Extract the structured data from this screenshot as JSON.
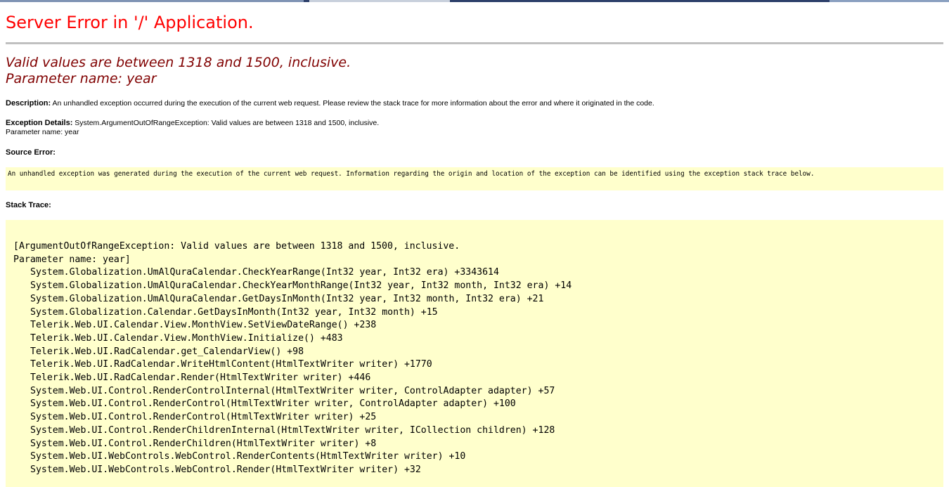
{
  "header": {
    "title": "Server Error in '/' Application.",
    "error_line1": "Valid values are between 1318 and 1500, inclusive.",
    "error_line2": "Parameter name: year"
  },
  "description": {
    "label": "Description:",
    "text": "An unhandled exception occurred during the execution of the current web request. Please review the stack trace for more information about the error and where it originated in the code."
  },
  "exception_details": {
    "label": "Exception Details:",
    "text": "System.ArgumentOutOfRangeException: Valid values are between 1318 and 1500, inclusive.",
    "text2": "Parameter name: year"
  },
  "source_error": {
    "label": "Source Error:",
    "text": "An unhandled exception was generated during the execution of the current web request. Information regarding the origin and location of the exception can be identified using the exception stack trace below."
  },
  "stack_trace": {
    "label": "Stack Trace:",
    "lines": [
      "[ArgumentOutOfRangeException: Valid values are between 1318 and 1500, inclusive.",
      "Parameter name: year]",
      "System.Globalization.UmAlQuraCalendar.CheckYearRange(Int32 year, Int32 era) +3343614",
      "System.Globalization.UmAlQuraCalendar.CheckYearMonthRange(Int32 year, Int32 month, Int32 era) +14",
      "System.Globalization.UmAlQuraCalendar.GetDaysInMonth(Int32 year, Int32 month, Int32 era) +21",
      "System.Globalization.Calendar.GetDaysInMonth(Int32 year, Int32 month) +15",
      "Telerik.Web.UI.Calendar.View.MonthView.SetViewDateRange() +238",
      "Telerik.Web.UI.Calendar.View.MonthView.Initialize() +483",
      "Telerik.Web.UI.RadCalendar.get_CalendarView() +98",
      "Telerik.Web.UI.RadCalendar.WriteHtmlContent(HtmlTextWriter writer) +1770",
      "Telerik.Web.UI.RadCalendar.Render(HtmlTextWriter writer) +446",
      "System.Web.UI.Control.RenderControlInternal(HtmlTextWriter writer, ControlAdapter adapter) +57",
      "System.Web.UI.Control.RenderControl(HtmlTextWriter writer, ControlAdapter adapter) +100",
      "System.Web.UI.Control.RenderControl(HtmlTextWriter writer) +25",
      "System.Web.UI.Control.RenderChildrenInternal(HtmlTextWriter writer, ICollection children) +128",
      "System.Web.UI.Control.RenderChildren(HtmlTextWriter writer) +8",
      "System.Web.UI.WebControls.WebControl.RenderContents(HtmlTextWriter writer) +10",
      "System.Web.UI.WebControls.WebControl.Render(HtmlTextWriter writer) +32"
    ]
  },
  "colors": {
    "title": "#ff0000",
    "error_message": "#800000",
    "code_background": "#ffffcc",
    "rule": "#c0c0c0"
  }
}
